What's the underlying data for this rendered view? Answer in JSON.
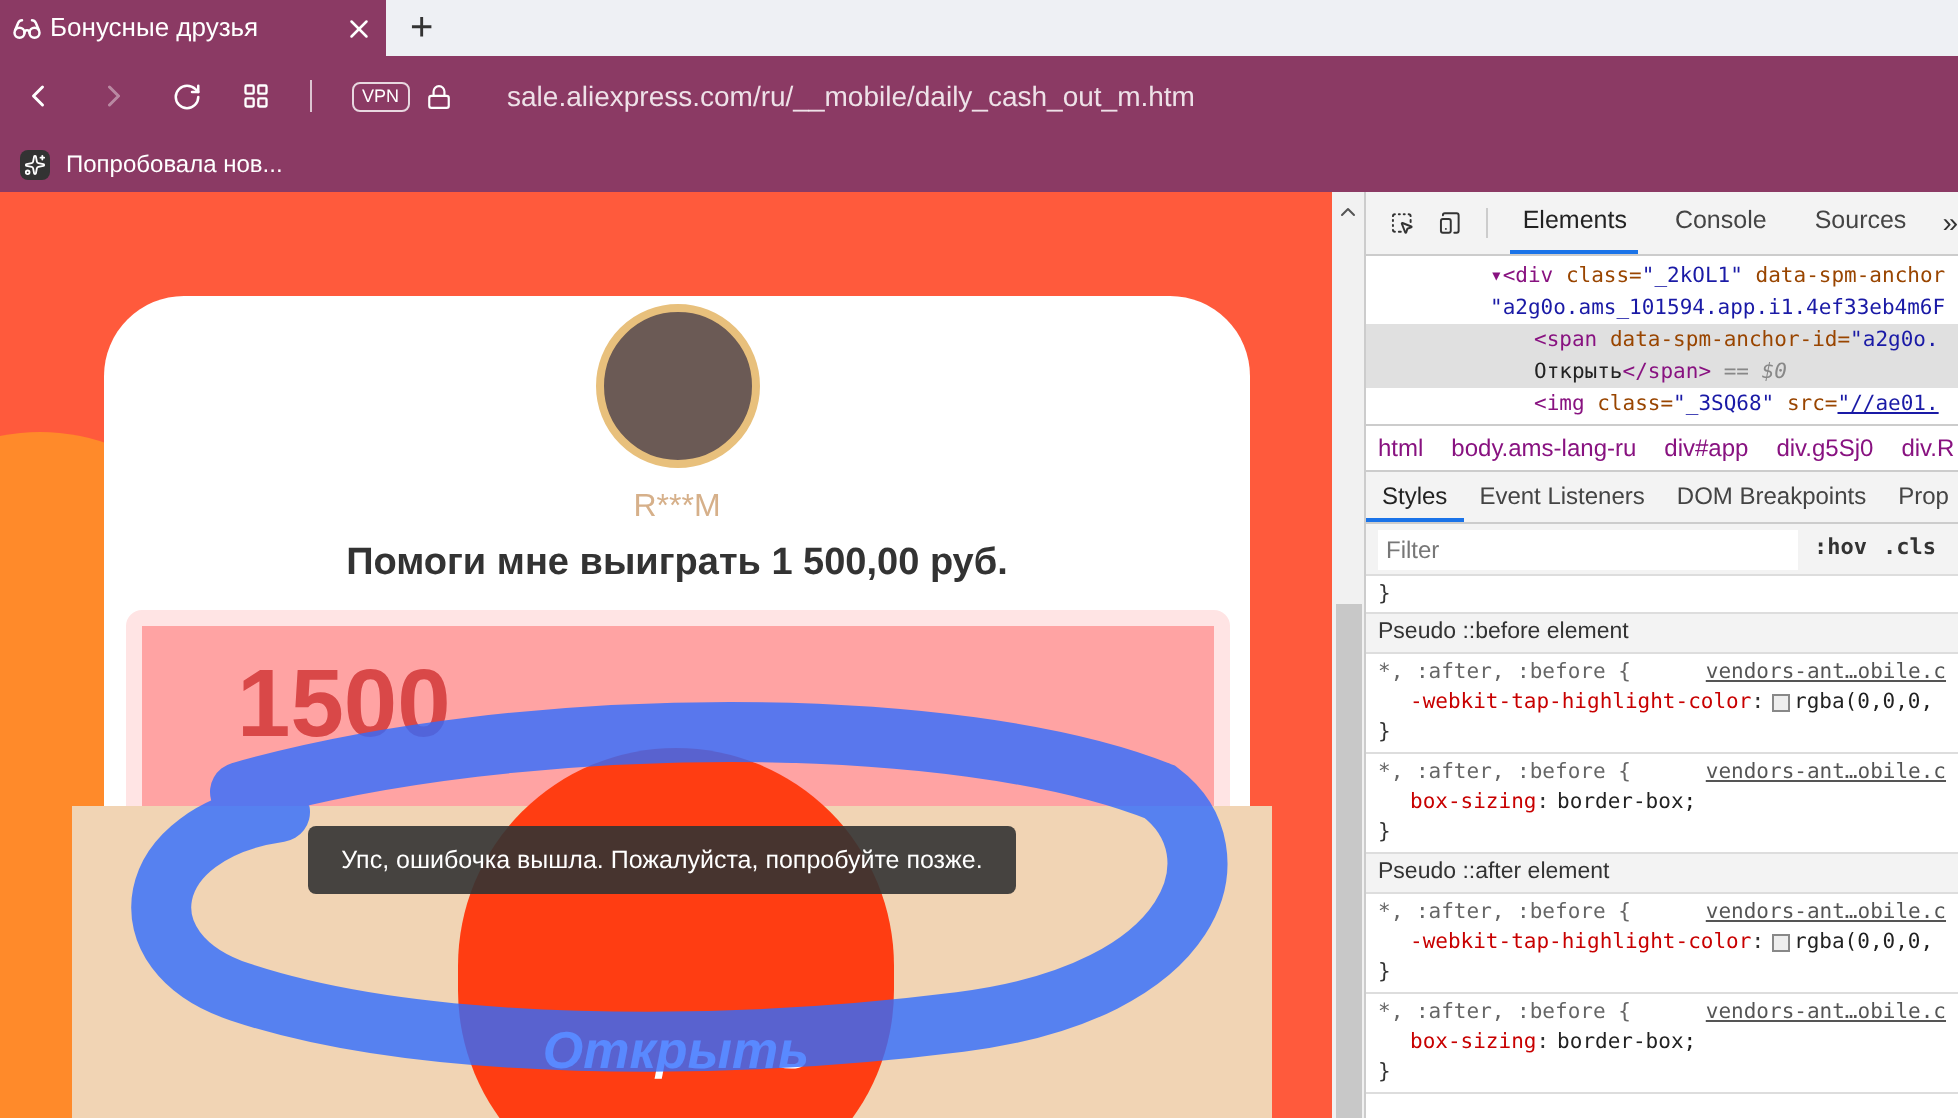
{
  "browser": {
    "tab": {
      "title": "Бонусные друзья",
      "selected": true
    },
    "new_tab": "+",
    "url": {
      "host": "sale.aliexpress.com",
      "path": "/ru/__mobile/daily_cash_out_m.htm"
    },
    "vpn_badge": "VPN",
    "bookmark": "Попробовала нов..."
  },
  "page": {
    "user_name": "R***M",
    "heading": "Помоги мне выиграть 1 500,00 руб.",
    "coupon_amount": "1500",
    "open_button": "Открыть",
    "toast": "Упс, ошибочка вышла. Пожалуйста, попробуйте позже."
  },
  "devtools": {
    "tabs": [
      {
        "label": "Elements",
        "selected": true
      },
      {
        "label": "Console",
        "selected": false
      },
      {
        "label": "Sources",
        "selected": false
      }
    ],
    "more": "»",
    "dom_lines": [
      {
        "selected": false,
        "indent": false,
        "parts": [
          {
            "kind": "tag",
            "text": "▾<div "
          },
          {
            "kind": "attr",
            "text": "class="
          },
          {
            "kind": "value",
            "text": "\"_2kOL1\" "
          },
          {
            "kind": "attr",
            "text": "data-spm-anchor"
          }
        ]
      },
      {
        "selected": false,
        "indent": false,
        "parts": [
          {
            "kind": "value",
            "text": "\"a2g0o.ams_101594.app.i1.4ef33eb4m6F"
          }
        ]
      },
      {
        "selected": true,
        "indent": true,
        "parts": [
          {
            "kind": "tag",
            "text": "<span "
          },
          {
            "kind": "attr",
            "text": "data-spm-anchor-id="
          },
          {
            "kind": "value",
            "text": "\"a2g0o."
          }
        ]
      },
      {
        "selected": true,
        "indent": true,
        "parts": [
          {
            "kind": "text",
            "text": "Открыть"
          },
          {
            "kind": "tag",
            "text": "</span>"
          },
          {
            "kind": "muted",
            "text": " == $0"
          }
        ]
      },
      {
        "selected": false,
        "indent": true,
        "parts": [
          {
            "kind": "tag",
            "text": "<img "
          },
          {
            "kind": "attr",
            "text": "class="
          },
          {
            "kind": "value",
            "text": "\"_3SQ68\" "
          },
          {
            "kind": "attr",
            "text": "src="
          },
          {
            "kind": "link",
            "text": "\"//ae01."
          }
        ]
      }
    ],
    "breadcrumbs": [
      "html",
      "body.ams-lang-ru",
      "div#app",
      "div.g5Sj0",
      "div.R"
    ],
    "subtabs": [
      {
        "label": "Styles",
        "selected": true
      },
      {
        "label": "Event Listeners",
        "selected": false
      },
      {
        "label": "DOM Breakpoints",
        "selected": false
      },
      {
        "label": "Prop",
        "selected": false
      }
    ],
    "filter": {
      "placeholder": "Filter"
    },
    "hov": ":hov",
    "cls": ".cls",
    "closing_brace": "}",
    "sections": [
      {
        "header": "Pseudo ::before element",
        "rules": [
          {
            "selector": "*, :after, :before {",
            "source": "vendors-ant…obile.c",
            "declarations": [
              {
                "property": "-webkit-tap-highlight-color",
                "colon": ":",
                "value": "rgba(0,0,0,",
                "swatch": true
              }
            ],
            "close": "}"
          },
          {
            "selector": "*, :after, :before {",
            "source": "vendors-ant…obile.c",
            "declarations": [
              {
                "property": "box-sizing",
                "colon": ":",
                "value": "border-box;",
                "swatch": false
              }
            ],
            "close": "}"
          }
        ]
      },
      {
        "header": "Pseudo ::after element",
        "rules": [
          {
            "selector": "*, :after, :before {",
            "source": "vendors-ant…obile.c",
            "declarations": [
              {
                "property": "-webkit-tap-highlight-color",
                "colon": ":",
                "value": "rgba(0,0,0,",
                "swatch": true
              }
            ],
            "close": "}"
          },
          {
            "selector": "*, :after, :before {",
            "source": "vendors-ant…obile.c",
            "declarations": [
              {
                "property": "box-sizing",
                "colon": ":",
                "value": "border-box;",
                "swatch": false
              }
            ],
            "close": "}"
          }
        ]
      }
    ]
  }
}
